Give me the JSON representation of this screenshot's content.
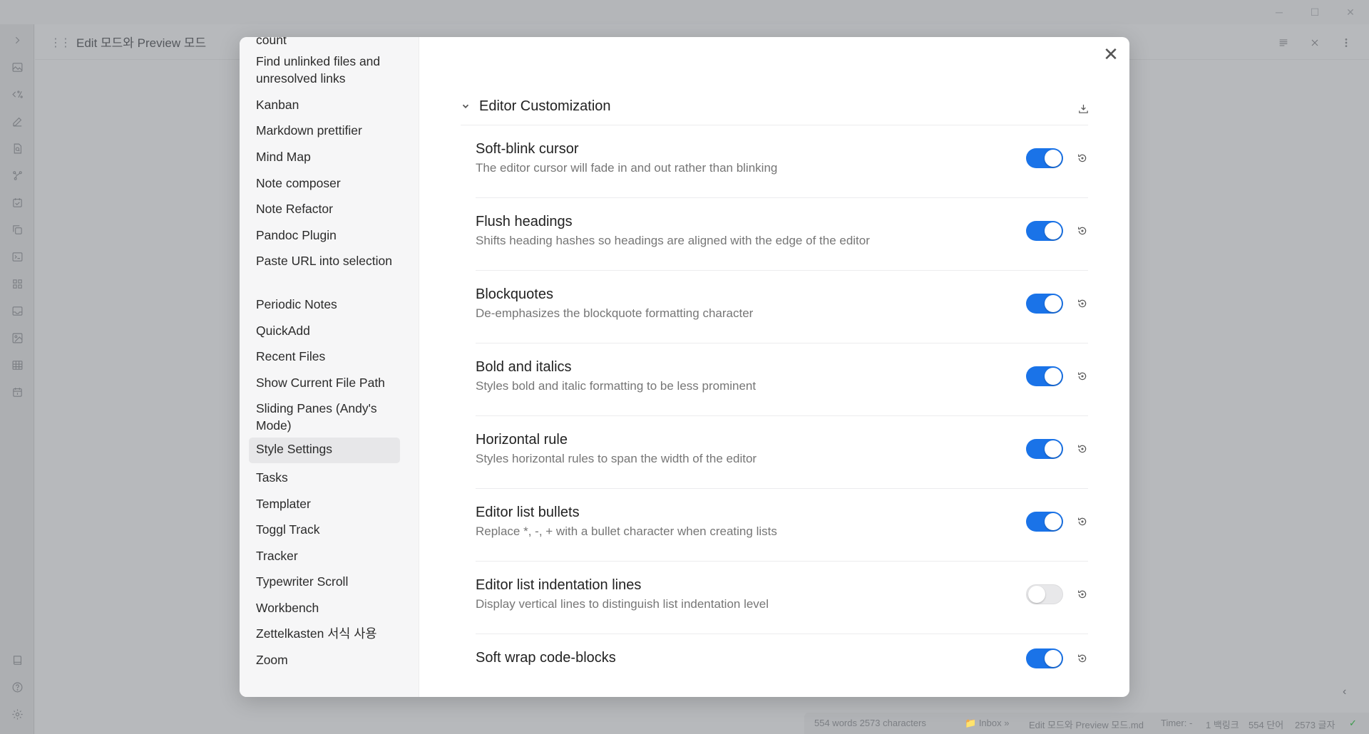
{
  "window": {
    "minimize": "─",
    "maximize": "☐",
    "close": "✕"
  },
  "tab": {
    "title": "Edit 모드와 Preview 모드"
  },
  "ribbon_icons": [
    "expand-icon",
    "image-icon",
    "template-icon",
    "pencil-icon",
    "search-doc-icon",
    "graph-icon",
    "calendar-check-icon",
    "copy-icon",
    "terminal-icon",
    "plugins-grid-icon",
    "inbox-icon",
    "image-gallery-icon",
    "table-icon",
    "calendar-icon",
    "vault-icon",
    "help-icon",
    "settings-icon"
  ],
  "modal": {
    "close": "✕",
    "nav": {
      "items": [
        {
          "label": "count"
        },
        {
          "label": "Find unlinked files and unresolved links"
        },
        {
          "label": "Kanban"
        },
        {
          "label": "Markdown prettifier"
        },
        {
          "label": "Mind Map"
        },
        {
          "label": "Note composer"
        },
        {
          "label": "Note Refactor"
        },
        {
          "label": "Pandoc Plugin"
        },
        {
          "label": "Paste URL into selection"
        },
        {
          "label": "Periodic Notes"
        },
        {
          "label": "QuickAdd"
        },
        {
          "label": "Recent Files"
        },
        {
          "label": "Show Current File Path"
        },
        {
          "label": "Sliding Panes (Andy's Mode)"
        },
        {
          "label": "Style Settings",
          "active": true
        },
        {
          "label": "Tasks"
        },
        {
          "label": "Templater"
        },
        {
          "label": "Toggl Track"
        },
        {
          "label": "Tracker"
        },
        {
          "label": "Typewriter Scroll"
        },
        {
          "label": "Workbench"
        },
        {
          "label": "Zettelkasten 서식 사용"
        },
        {
          "label": "Zoom"
        }
      ]
    },
    "section": {
      "title": "Editor Customization"
    },
    "settings": [
      {
        "name": "Soft-blink cursor",
        "desc": "The editor cursor will fade in and out rather than blinking",
        "enabled": true
      },
      {
        "name": "Flush headings",
        "desc": "Shifts heading hashes so headings are aligned with the edge of the editor",
        "enabled": true
      },
      {
        "name": "Blockquotes",
        "desc": "De-emphasizes the blockquote formatting character",
        "enabled": true
      },
      {
        "name": "Bold and italics",
        "desc": "Styles bold and italic formatting to be less prominent",
        "enabled": true
      },
      {
        "name": "Horizontal rule",
        "desc": "Styles horizontal rules to span the width of the editor",
        "enabled": true
      },
      {
        "name": "Editor list bullets",
        "desc": "Replace *, -, + with a bullet character when creating lists",
        "enabled": true
      },
      {
        "name": "Editor list indentation lines",
        "desc": "Display vertical lines to distinguish list indentation level",
        "enabled": false
      },
      {
        "name": "Soft wrap code-blocks",
        "desc": "",
        "enabled": true
      }
    ]
  },
  "status": {
    "counts": "554 words 2573 characters",
    "path": "Inbox » ",
    "file": "Edit 모드와 Preview 모드.md",
    "timer": "Timer: -",
    "backlinks": "1 백링크",
    "words_ko": "554 단어",
    "chars_ko": "2573 글자",
    "sync": "✓"
  },
  "colors": {
    "accent": "#1a73e8",
    "toggle_off": "#e8e8ea"
  }
}
